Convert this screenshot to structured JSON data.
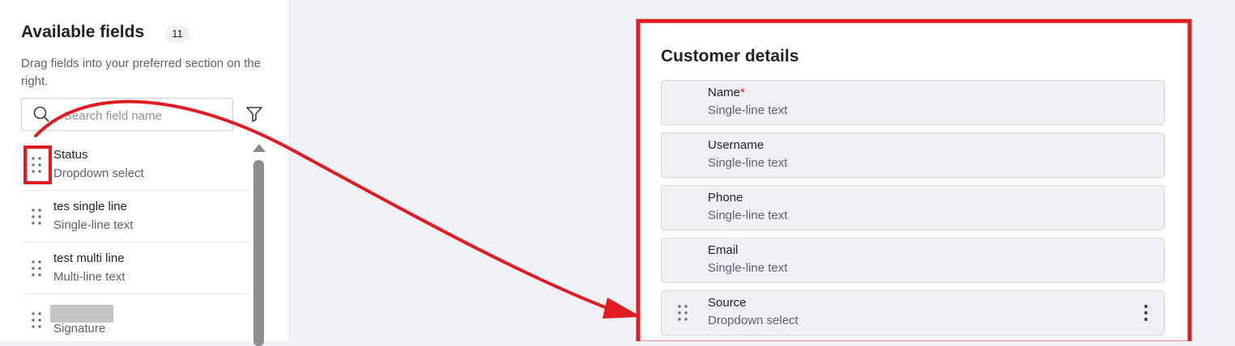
{
  "sidebar": {
    "title": "Available fields",
    "count": "11",
    "description": "Drag fields into your preferred section on the right.",
    "search": {
      "placeholder": "Search field name",
      "value": ""
    },
    "icons": {
      "search": "search-icon",
      "filter": "filter-icon",
      "drag": "drag-handle-icon"
    },
    "fields": [
      {
        "name": "Status",
        "type": "Dropdown select"
      },
      {
        "name": "tes single line",
        "type": "Single-line text"
      },
      {
        "name": "test multi line",
        "type": "Multi-line text"
      },
      {
        "name": "",
        "type": "Signature"
      }
    ]
  },
  "section": {
    "title": "Customer details",
    "required_marker": "*",
    "rows": [
      {
        "name": "Name",
        "type": "Single-line text",
        "required": true
      },
      {
        "name": "Username",
        "type": "Single-line text",
        "required": false
      },
      {
        "name": "Phone",
        "type": "Single-line text",
        "required": false
      },
      {
        "name": "Email",
        "type": "Single-line text",
        "required": false
      },
      {
        "name": "Source",
        "type": "Dropdown select",
        "required": false
      }
    ],
    "icons": {
      "drag": "drag-handle-icon",
      "more": "more-vertical-icon"
    }
  },
  "annotation": {
    "color": "#e21b23",
    "description_marks": [
      "highlight-box-drag-handle",
      "highlight-box-section",
      "curved-arrow"
    ]
  },
  "colors": {
    "page_bg": "#eef1f6",
    "panel_bg": "#ffffff",
    "row_bg": "#eff0f3",
    "required": "#c62828"
  }
}
